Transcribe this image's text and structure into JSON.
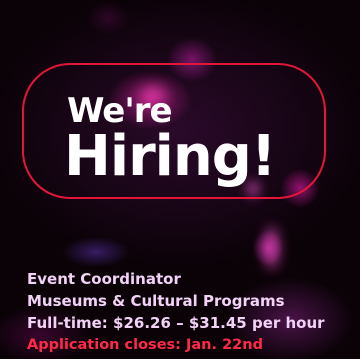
{
  "poster": {
    "headline_line1": "We're",
    "headline_line2": "Hiring!",
    "job_title": "Event Coordinator",
    "department": "Museums & Cultural Programs",
    "pay": "Full-time: $26.26 – $31.45 per hour",
    "deadline": "Application closes: Jan. 22nd"
  },
  "colors": {
    "frame_red": "#e3163a",
    "text_light": "#f2d3f7",
    "deadline_red": "#ff2a46",
    "headline": "#ffffff"
  }
}
